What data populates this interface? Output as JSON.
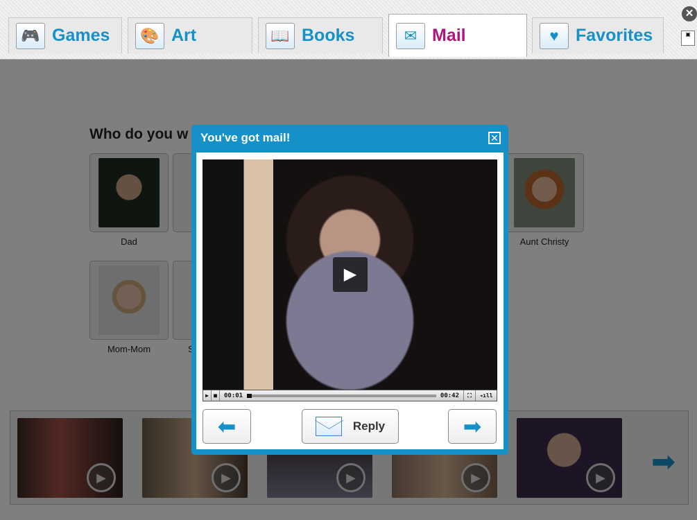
{
  "tabs": [
    {
      "label": "Games",
      "icon": "gamepad-icon",
      "active": false
    },
    {
      "label": "Art",
      "icon": "palette-icon",
      "active": false
    },
    {
      "label": "Books",
      "icon": "book-icon",
      "active": false
    },
    {
      "label": "Mail",
      "icon": "envelope-icon",
      "active": true
    },
    {
      "label": "Favorites",
      "icon": "heart-icon",
      "active": false
    }
  ],
  "window": {
    "close": "✕"
  },
  "main": {
    "heading": "Who do you w",
    "people": [
      {
        "name": "Dad"
      },
      {
        "name": "Aunt Christy"
      },
      {
        "name": "Mom-Mom"
      },
      {
        "name": "S"
      }
    ]
  },
  "modal": {
    "title": "You've got mail!",
    "close": "✕",
    "video": {
      "current_time": "00:01",
      "duration": "00:42",
      "progress": 0.024
    },
    "reply_label": "Reply"
  },
  "colors": {
    "accent": "#1591c8",
    "active_tab": "#b0177e"
  }
}
